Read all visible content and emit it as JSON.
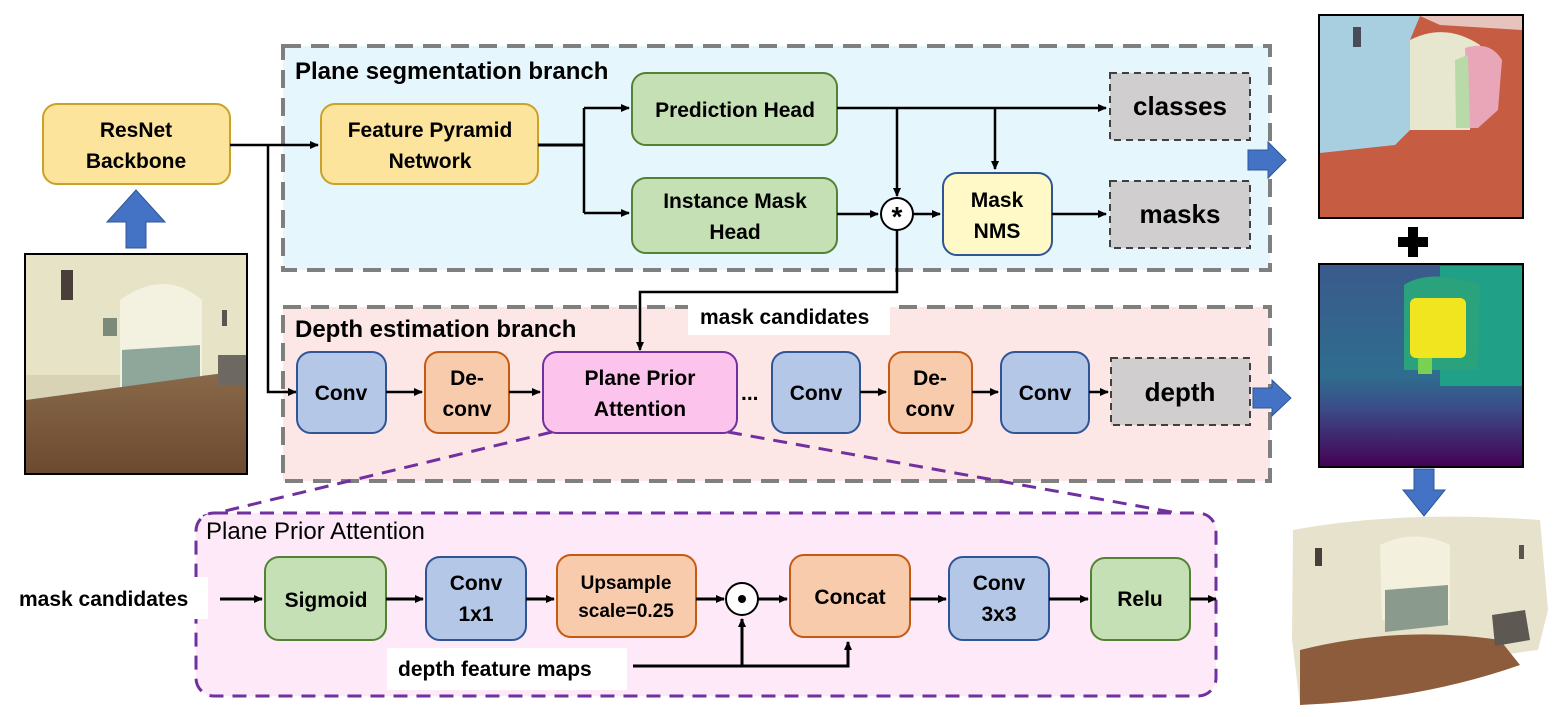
{
  "backbone": {
    "label_line1": "ResNet",
    "label_line2": "Backbone"
  },
  "segmentation_branch": {
    "title": "Plane segmentation branch",
    "fpn": {
      "line1": "Feature Pyramid",
      "line2": "Network"
    },
    "prediction_head": "Prediction Head",
    "instance_mask_head": {
      "line1": "Instance Mask",
      "line2": "Head"
    },
    "mask_nms": {
      "line1": "Mask",
      "line2": "NMS"
    },
    "outputs": [
      "classes",
      "masks"
    ],
    "combine_operator": "*"
  },
  "mask_candidates_label": "mask candidates",
  "depth_branch": {
    "title": "Depth estimation branch",
    "blocks": [
      {
        "line1": "Conv",
        "line2": ""
      },
      {
        "line1": "De-",
        "line2": "conv"
      },
      {
        "line1": "Plane Prior",
        "line2": "Attention"
      },
      {
        "line1": "Conv",
        "line2": ""
      },
      {
        "line1": "De-",
        "line2": "conv"
      },
      {
        "line1": "Conv",
        "line2": ""
      }
    ],
    "ellipsis": "...",
    "output": "depth"
  },
  "ppa_detail": {
    "title": "Plane Prior Attention",
    "input_label": "mask candidates",
    "blocks": [
      {
        "line1": "Sigmoid",
        "line2": ""
      },
      {
        "line1": "Conv",
        "line2": "1x1"
      },
      {
        "line1": "Upsample",
        "line2": "scale=0.25"
      },
      {
        "line1": "Concat",
        "line2": ""
      },
      {
        "line1": "Conv",
        "line2": "3x3"
      },
      {
        "line1": "Relu",
        "line2": ""
      }
    ],
    "elementwise_operator": "•",
    "feature_label": "depth feature maps"
  },
  "outputs_panel": {
    "combine_symbol": "+",
    "images": [
      "input-room-photo",
      "segmentation-result",
      "depth-map",
      "3d-reconstruction"
    ]
  },
  "colors": {
    "yellow_fill": "#fce49c",
    "yellow_stroke": "#c9a227",
    "green_fill": "#c5e0b4",
    "green_stroke": "#548235",
    "blue_fill": "#b4c7e7",
    "blue_stroke": "#2f5597",
    "orange_fill": "#f8cbad",
    "orange_stroke": "#c55a11",
    "pink_fill": "#fcc3ec",
    "pink_stroke": "#7030a0",
    "nms_fill": "#fff9c7",
    "output_fill": "#d0cece",
    "seg_bg": "#e6f6fd",
    "depth_bg": "#fde6e6",
    "ppa_bg": "#fde9f8",
    "arrow_blue": "#4472c4",
    "dashed_gray": "#7f7f7f",
    "dashed_purple": "#7030a0"
  }
}
